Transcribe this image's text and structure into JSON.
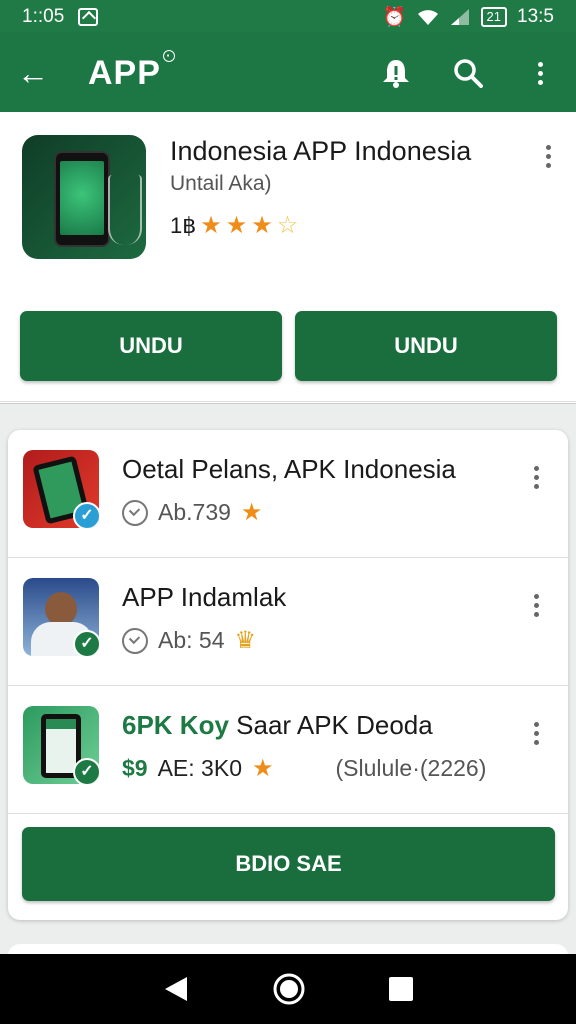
{
  "status_bar": {
    "time_left": "1::05",
    "battery": "21",
    "time_right": "13:5"
  },
  "app_bar": {
    "title": "APP"
  },
  "hero": {
    "title": "Indonesia APP Indonesia",
    "subtitle": "Untail Aka)",
    "rating_label": "1฿",
    "stars": 3.5,
    "button_left": "UNDU",
    "button_right": "UNDU"
  },
  "list": [
    {
      "name": "Oetal Pelans, APK Indonesia",
      "meta": "Ab.739",
      "badge": "star-icon",
      "check_color": "#2a9fd6"
    },
    {
      "name": "APP Indamlak",
      "meta": "Ab: 54",
      "badge": "crown-icon",
      "check_color": "#1e7a44"
    },
    {
      "name_green": "6PK Koy",
      "name_rest": " Saar APK Deoda",
      "price": "$9",
      "meta": "AE: 3K0",
      "extra": "(Slulule·(2226)",
      "badge": "star-icon",
      "check_color": "#1e7a44"
    }
  ],
  "list_button": "BDIO SAE",
  "colors": {
    "primary": "#1d7744",
    "star": "#ef8d1b"
  }
}
